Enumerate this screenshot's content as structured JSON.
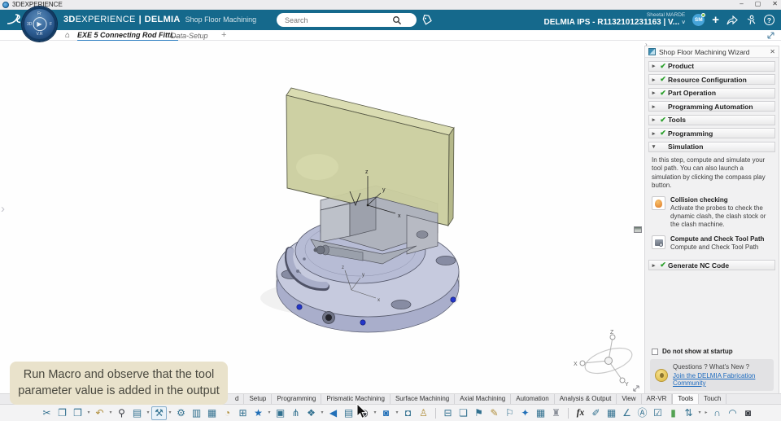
{
  "os_bar": {
    "title": "3DEXPERIENCE",
    "minimize": "–",
    "maximize": "▢",
    "close": "✕"
  },
  "header": {
    "brand_3d": "3D",
    "brand_experience": "EXPERIENCE",
    "divider": "|",
    "app_name": "DELMIA",
    "module_name": "Shop Floor Machining",
    "search_placeholder": "Search",
    "user_name": "Sheetal MARDE",
    "workspace_label": "DELMIA IPS - R1132101231163 | V...",
    "workspace_caret": "˅",
    "avatar_initials": "SM",
    "add_label": "+",
    "help_label": "?",
    "play_glyph": "▶",
    "compass_labels": {
      "top": "Fr",
      "left": "3D",
      "right": "F",
      "bottom": "V.R"
    }
  },
  "tab_bar": {
    "home_glyph": "⌂",
    "active_tab": "EXE 5 Connecting Rod Fitti...",
    "inactive_tab": "Data-Setup",
    "new_tab": "+"
  },
  "viewport": {
    "collapse_glyph": "›",
    "axis": {
      "x": "x",
      "y": "y",
      "z": "z"
    },
    "compass": {
      "x": "X",
      "y": "Y",
      "z": "Z"
    }
  },
  "wizard": {
    "title": "Shop Floor Machining Wizard",
    "close_glyph": "✕",
    "collapse_glyph": "›",
    "sections": [
      {
        "arrow": "▸",
        "check": "✔",
        "label": "Product",
        "click": "true"
      },
      {
        "arrow": "▸",
        "check": "✔",
        "label": "Resource Configuration",
        "click": "true"
      },
      {
        "arrow": "▸",
        "check": "✔",
        "label": "Part Operation",
        "click": "true"
      },
      {
        "arrow": "▸",
        "check": "",
        "label": "Programming Automation",
        "click": "true"
      },
      {
        "arrow": "▸",
        "check": "✔",
        "label": "Tools",
        "click": "true"
      },
      {
        "arrow": "▸",
        "check": "✔",
        "label": "Programming",
        "click": "true"
      }
    ],
    "simulation": {
      "arrow": "▾",
      "label": "Simulation",
      "description": "In this step, compute and simulate your tool path. You can also launch a simulation by clicking the compass play button.",
      "items": [
        {
          "title": "Collision checking",
          "description": "Activate the probes to check the dynamic clash, the clash stock or the clash machine.",
          "icon": "collision-icon",
          "click": "true"
        },
        {
          "title": "Compute and Check Tool Path",
          "description": "Compute and Check Tool Path",
          "icon": "compute-tool-path-icon",
          "click": "true"
        }
      ]
    },
    "generate": {
      "arrow": "▸",
      "check": "✔",
      "label": "Generate NC Code"
    },
    "footer": {
      "checkbox_label": "Do not show at startup",
      "question_text": "Questions ? What's New ?",
      "link_text": "Join the DELMIA Fabrication Community"
    }
  },
  "caption": {
    "text": "Run Macro and observe that the tool parameter value is added in the output"
  },
  "bottom_tabs": {
    "tabs": [
      {
        "label": "d",
        "state": "",
        "click": "true"
      },
      {
        "label": "Setup",
        "state": "",
        "click": "true"
      },
      {
        "label": "Programming",
        "state": "",
        "click": "true"
      },
      {
        "label": "Prismatic Machining",
        "state": "",
        "click": "true"
      },
      {
        "label": "Surface Machining",
        "state": "",
        "click": "true"
      },
      {
        "label": "Axial Machining",
        "state": "",
        "click": "true"
      },
      {
        "label": "Automation",
        "state": "",
        "click": "true"
      },
      {
        "label": "Analysis & Output",
        "state": "",
        "click": "true"
      },
      {
        "label": "View",
        "state": "",
        "click": "true"
      },
      {
        "label": "AR-VR",
        "state": "",
        "click": "true"
      },
      {
        "label": "Tools",
        "state": "active",
        "click": "true"
      },
      {
        "label": "Touch",
        "state": "",
        "click": "true"
      }
    ]
  },
  "toolbar": {
    "items": [
      {
        "name": "cut-icon",
        "glyph": "✂",
        "tone": "steel",
        "click": "true"
      },
      {
        "name": "copy-icon",
        "glyph": "❐",
        "tone": "steel",
        "click": "true"
      },
      {
        "name": "paste-icon",
        "glyph": "❒",
        "tone": "steel",
        "click": "true"
      },
      {
        "name": "dropdown-caret",
        "glyph": "▾",
        "tone": "caret",
        "click": "true"
      },
      {
        "name": "undo-icon",
        "glyph": "↶",
        "tone": "gold",
        "click": "true"
      },
      {
        "name": "dropdown-caret",
        "glyph": "▾",
        "tone": "caret",
        "click": "true"
      },
      {
        "name": "search-icon",
        "glyph": "⚲",
        "tone": "dark",
        "click": "true"
      },
      {
        "name": "catalog-icon",
        "glyph": "▤",
        "tone": "steel",
        "click": "true"
      },
      {
        "name": "dropdown-caret",
        "glyph": "▾",
        "tone": "caret",
        "click": "true"
      },
      {
        "name": "probe-tool-icon",
        "glyph": "⚒",
        "tone": "steel",
        "frame": "boxed",
        "click": "true"
      },
      {
        "name": "dropdown-caret",
        "glyph": "▾",
        "tone": "caret",
        "click": "true"
      },
      {
        "name": "tool-settings-icon",
        "glyph": "⚙",
        "tone": "steel",
        "click": "true"
      },
      {
        "name": "edit-list-icon",
        "glyph": "▥",
        "tone": "steel",
        "click": "true"
      },
      {
        "name": "view-grid-icon",
        "glyph": "▦",
        "tone": "steel",
        "click": "true"
      },
      {
        "name": "resources-chart-icon",
        "glyph": "◔",
        "tone": "gold",
        "click": "true"
      },
      {
        "name": "frame-select-icon",
        "glyph": "⊞",
        "tone": "steel",
        "click": "true"
      },
      {
        "name": "favorites-star-icon",
        "glyph": "★",
        "tone": "blue",
        "click": "true"
      },
      {
        "name": "dropdown-caret",
        "glyph": "▾",
        "tone": "caret",
        "click": "true"
      },
      {
        "name": "memory-chip-icon",
        "glyph": "▣",
        "tone": "steel",
        "click": "true"
      },
      {
        "name": "hierarchy-icon",
        "glyph": "⋔",
        "tone": "steel",
        "click": "true"
      },
      {
        "name": "display-settings-icon",
        "glyph": "❖",
        "tone": "steel",
        "click": "true"
      },
      {
        "name": "dropdown-caret",
        "glyph": "▾",
        "tone": "caret",
        "click": "true"
      },
      {
        "name": "back-icon",
        "glyph": "◀",
        "tone": "blue",
        "click": "true"
      },
      {
        "name": "operations-list-icon",
        "glyph": "▤",
        "tone": "steel",
        "click": "true"
      },
      {
        "name": "record-macro-icon",
        "glyph": "◉",
        "tone": "dark",
        "click": "true"
      },
      {
        "name": "dropdown-caret",
        "glyph": "▾",
        "tone": "caret",
        "click": "true"
      },
      {
        "name": "video-capture-icon",
        "glyph": "◙",
        "tone": "blue",
        "click": "true"
      },
      {
        "name": "dropdown-caret",
        "glyph": "▾",
        "tone": "caret",
        "click": "true"
      },
      {
        "name": "camera-icon",
        "glyph": "◘",
        "tone": "steel",
        "click": "true"
      },
      {
        "name": "simulation-player-icon",
        "glyph": "♙",
        "tone": "gold",
        "click": "true"
      },
      {
        "name": "separator",
        "glyph": "",
        "tone": "sep",
        "click": "false"
      },
      {
        "name": "monitor-tree-icon",
        "glyph": "⊟",
        "tone": "steel",
        "click": "true"
      },
      {
        "name": "stack-icon",
        "glyph": "❏",
        "tone": "steel",
        "click": "true"
      },
      {
        "name": "flag-tool-icon",
        "glyph": "⚑",
        "tone": "steel",
        "click": "true"
      },
      {
        "name": "pencil-icon",
        "glyph": "✎",
        "tone": "gold",
        "click": "true"
      },
      {
        "name": "flag-check-icon",
        "glyph": "⚐",
        "tone": "steel",
        "click": "true"
      },
      {
        "name": "fixture-icon",
        "glyph": "✦",
        "tone": "blue",
        "click": "true"
      },
      {
        "name": "stock-boxes-icon",
        "glyph": "▦",
        "tone": "steel",
        "click": "true"
      },
      {
        "name": "machine-icon",
        "glyph": "♜",
        "tone": "gray",
        "click": "true"
      },
      {
        "name": "separator",
        "glyph": "",
        "tone": "sep",
        "click": "false"
      },
      {
        "name": "formula-fx-icon",
        "glyph": "fx",
        "tone": "fx",
        "click": "true"
      },
      {
        "name": "wand-icon",
        "glyph": "✐",
        "tone": "steel",
        "click": "true"
      },
      {
        "name": "table-icon",
        "glyph": "▦",
        "tone": "steel",
        "click": "true"
      },
      {
        "name": "measure-icon",
        "glyph": "∠",
        "tone": "steel",
        "click": "true"
      },
      {
        "name": "annotation-icon",
        "glyph": "Ⓐ",
        "tone": "steel",
        "click": "true"
      },
      {
        "name": "checklist-icon",
        "glyph": "☑",
        "tone": "steel",
        "click": "true"
      },
      {
        "name": "status-bar-icon",
        "glyph": "▮",
        "tone": "green",
        "click": "true"
      },
      {
        "name": "sliders-icon",
        "glyph": "⇅",
        "tone": "steel",
        "click": "true"
      },
      {
        "name": "dropdown-caret",
        "glyph": "▾",
        "tone": "caret",
        "click": "true"
      },
      {
        "name": "more-arrow",
        "glyph": "▸",
        "tone": "caret",
        "click": "true"
      },
      {
        "name": "probe-magnet-icon",
        "glyph": "∩",
        "tone": "steel",
        "click": "true"
      },
      {
        "name": "probe-dome-icon",
        "glyph": "◠",
        "tone": "steel",
        "click": "true"
      },
      {
        "name": "snapshot-settings-icon",
        "glyph": "◙",
        "tone": "dark",
        "click": "true"
      }
    ]
  }
}
